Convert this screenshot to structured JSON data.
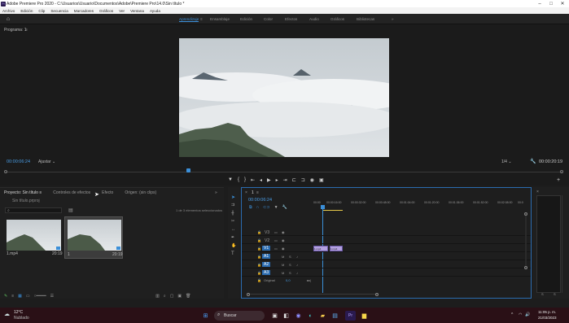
{
  "window": {
    "title": "Adobe Premiere Pro 2020 - C:\\Usuarios\\Usuario\\Documentos\\Adobe\\Premiere Pro\\14.0\\Sin título *"
  },
  "menu": [
    "Archivo",
    "Edición",
    "Clip",
    "Secuencia",
    "Marcadores",
    "Gráficos",
    "Ver",
    "Ventana",
    "Ayuda"
  ],
  "workspaces": [
    "Aprendizaje",
    "Ensamblaje",
    "Edición",
    "Color",
    "Efectos",
    "Audio",
    "Gráficos",
    "Bibliotecas"
  ],
  "program": {
    "label": "Programa: 1",
    "timecode": "00:00:06:24",
    "fit": "Ajustar",
    "quality": "1/4",
    "duration": "00:00:20:19"
  },
  "project": {
    "tabs": [
      "Proyecto: Sin título",
      "Controles de efectos",
      "Efecto",
      "Origen: (sin clips)"
    ],
    "file": "Sin título.prproj",
    "selection": "1 de 3 elementos seleccionados",
    "items": [
      {
        "name": "1.mp4",
        "duration": "20:19"
      },
      {
        "name": "1",
        "duration": "20:19"
      }
    ]
  },
  "timeline": {
    "seq": "1",
    "timecode": "00:00:06:24",
    "ruler": [
      "00:00",
      "00:00:16:00",
      "00:00:32:00",
      "00:00:48:00",
      "00:01:04:00",
      "00:01:20:00",
      "00:01:36:00",
      "00:01:52:00",
      "00:02:08:00",
      "00:0"
    ],
    "video_tracks": [
      "V3",
      "V2",
      "V1"
    ],
    "audio_tracks": [
      "A1",
      "A2",
      "A3"
    ],
    "master": "Original",
    "master_val": "0,0",
    "clip_v": "1.mp4",
    "clip_v2": "1.mp4"
  },
  "taskbar": {
    "temp": "12°C",
    "weather": "Nublado",
    "search": "Buscar",
    "time": "11:05 p. m.",
    "date": "21/03/2023"
  }
}
